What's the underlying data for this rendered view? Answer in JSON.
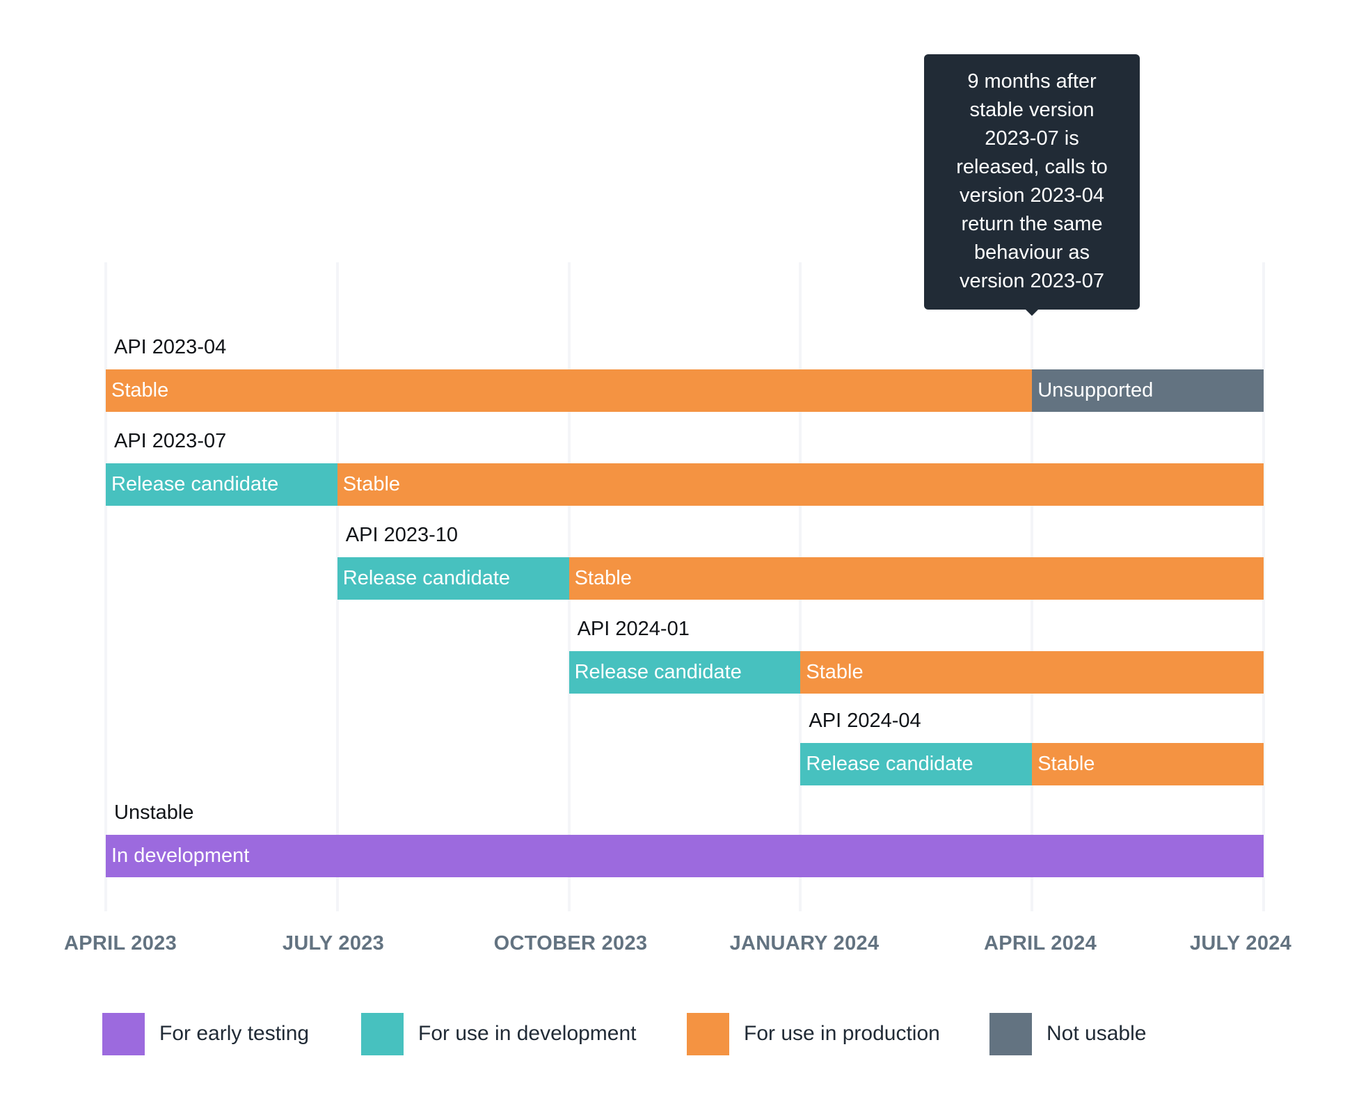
{
  "chart_data": {
    "type": "gantt",
    "title": "",
    "x_axis": {
      "ticks": [
        "APRIL 2023",
        "JULY 2023",
        "OCTOBER 2023",
        "JANUARY 2024",
        "APRIL 2024",
        "JULY 2024"
      ],
      "range": [
        "2023-04",
        "2024-07"
      ]
    },
    "rows": [
      {
        "label": "API 2023-04",
        "segments": [
          {
            "label": "Stable",
            "category": "production",
            "start": "2023-04",
            "end": "2024-04"
          },
          {
            "label": "Unsupported",
            "category": "not_usable",
            "start": "2024-04",
            "end": "2024-07"
          }
        ]
      },
      {
        "label": "API 2023-07",
        "segments": [
          {
            "label": "Release candidate",
            "category": "development",
            "start": "2023-04",
            "end": "2023-07"
          },
          {
            "label": "Stable",
            "category": "production",
            "start": "2023-07",
            "end": "2024-07"
          }
        ]
      },
      {
        "label": "API 2023-10",
        "segments": [
          {
            "label": "Release candidate",
            "category": "development",
            "start": "2023-07",
            "end": "2023-10"
          },
          {
            "label": "Stable",
            "category": "production",
            "start": "2023-10",
            "end": "2024-07"
          }
        ]
      },
      {
        "label": "API 2024-01",
        "segments": [
          {
            "label": "Release candidate",
            "category": "development",
            "start": "2023-10",
            "end": "2024-01"
          },
          {
            "label": "Stable",
            "category": "production",
            "start": "2024-01",
            "end": "2024-07"
          }
        ]
      },
      {
        "label": "API 2024-04",
        "segments": [
          {
            "label": "Release candidate",
            "category": "development",
            "start": "2024-01",
            "end": "2024-04"
          },
          {
            "label": "Stable",
            "category": "production",
            "start": "2024-04",
            "end": "2024-07"
          }
        ]
      },
      {
        "label": "Unstable",
        "segments": [
          {
            "label": "In development",
            "category": "early_testing",
            "start": "2023-04",
            "end": "2024-07"
          }
        ]
      }
    ],
    "legend": [
      {
        "key": "early_testing",
        "label": "For early testing",
        "color": "#9c6ade"
      },
      {
        "key": "development",
        "label": "For use in development",
        "color": "#47c1bf"
      },
      {
        "key": "production",
        "label": "For use in production",
        "color": "#f49342"
      },
      {
        "key": "not_usable",
        "label": "Not usable",
        "color": "#637381"
      }
    ],
    "legend_position": "bottom",
    "annotation": {
      "anchor": "2024-04",
      "lines": [
        "9 months after",
        "stable version",
        "2023-07  is",
        "released, calls to",
        "version  2023-04",
        "return the same",
        "behaviour as",
        "version  2023-07"
      ]
    },
    "grid": true
  }
}
